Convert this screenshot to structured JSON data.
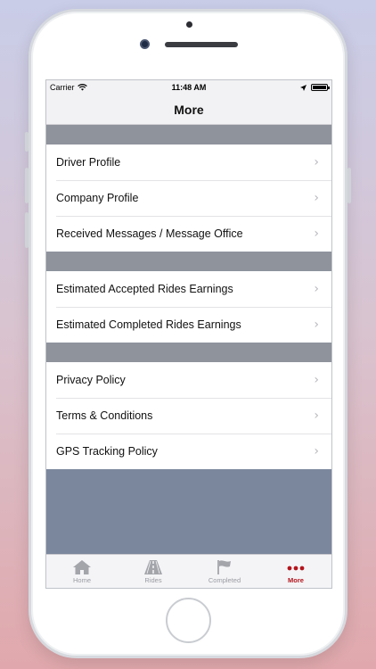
{
  "status_bar": {
    "carrier": "Carrier",
    "time": "11:48 AM"
  },
  "nav": {
    "title": "More"
  },
  "groups": [
    {
      "items": [
        {
          "label": "Driver Profile"
        },
        {
          "label": "Company Profile"
        },
        {
          "label": "Received Messages / Message Office"
        }
      ]
    },
    {
      "items": [
        {
          "label": "Estimated Accepted Rides Earnings"
        },
        {
          "label": "Estimated Completed Rides Earnings"
        }
      ]
    },
    {
      "items": [
        {
          "label": "Privacy Policy"
        },
        {
          "label": "Terms & Conditions"
        },
        {
          "label": "GPS Tracking Policy"
        }
      ]
    }
  ],
  "tabs": [
    {
      "label": "Home",
      "icon": "home-icon",
      "active": false
    },
    {
      "label": "Rides",
      "icon": "road-icon",
      "active": false
    },
    {
      "label": "Completed",
      "icon": "flag-icon",
      "active": false
    },
    {
      "label": "More",
      "icon": "more-dots-icon",
      "active": true
    }
  ],
  "colors": {
    "accent": "#b3141c",
    "section_gap": "#8e939c",
    "background_fill": "#7b879d"
  }
}
